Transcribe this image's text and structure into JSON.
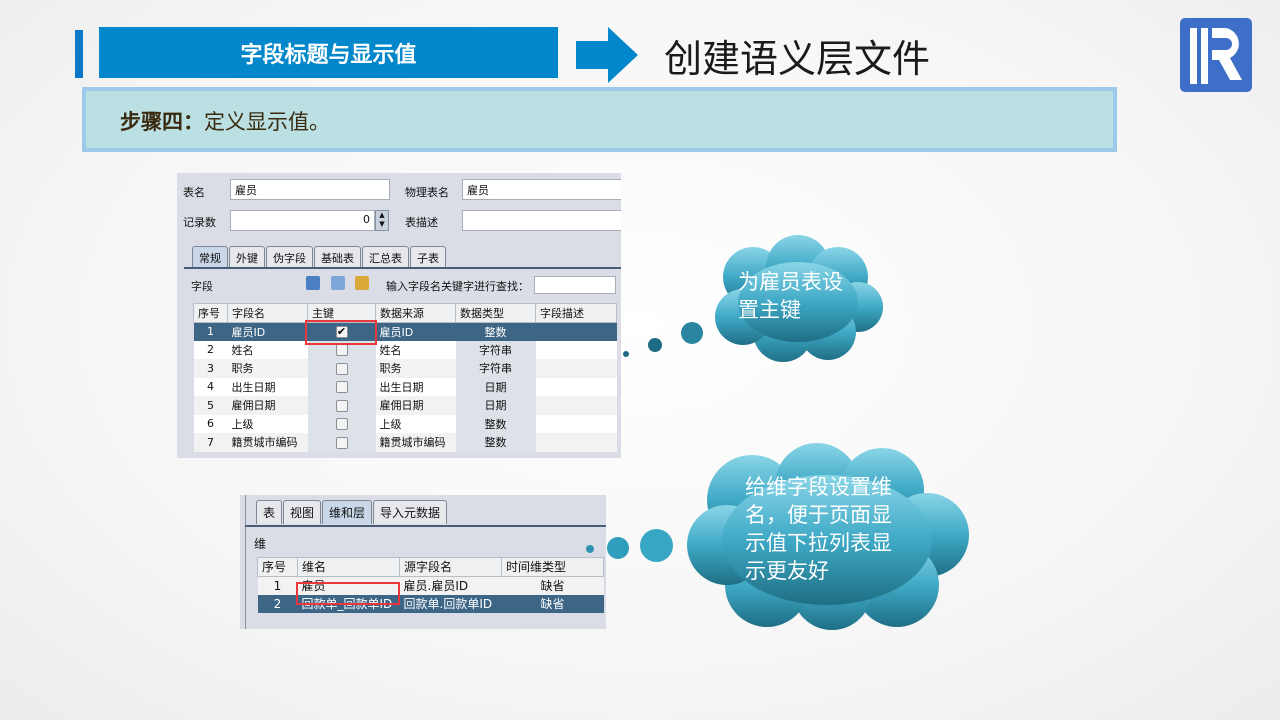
{
  "header": {
    "section_label": "字段标题与显示值",
    "main_title": "创建语义层文件",
    "logo_letter": "R"
  },
  "step": {
    "prefix": "步骤四：",
    "text": "定义显示值。"
  },
  "table_editor": {
    "table_name_label": "表名",
    "table_name": "雇员",
    "physical_name_label": "物理表名",
    "physical_name": "雇员",
    "record_count_label": "记录数",
    "record_count": "0",
    "table_desc_label": "表描述",
    "table_desc": "",
    "tabs": [
      "常规",
      "外键",
      "伪字段",
      "基础表",
      "汇总表",
      "子表"
    ],
    "fields_label": "字段",
    "search_label": "输入字段名关键字进行查找：",
    "search_value": "",
    "columns": [
      "序号",
      "字段名",
      "主键",
      "数据来源",
      "数据类型",
      "字段描述"
    ],
    "rows": [
      {
        "no": "1",
        "name": "雇员ID",
        "pk": true,
        "source": "雇员ID",
        "type": "整数",
        "desc": ""
      },
      {
        "no": "2",
        "name": "姓名",
        "pk": false,
        "source": "姓名",
        "type": "字符串",
        "desc": ""
      },
      {
        "no": "3",
        "name": "职务",
        "pk": false,
        "source": "职务",
        "type": "字符串",
        "desc": ""
      },
      {
        "no": "4",
        "name": "出生日期",
        "pk": false,
        "source": "出生日期",
        "type": "日期",
        "desc": ""
      },
      {
        "no": "5",
        "name": "雇佣日期",
        "pk": false,
        "source": "雇佣日期",
        "type": "日期",
        "desc": ""
      },
      {
        "no": "6",
        "name": "上级",
        "pk": false,
        "source": "上级",
        "type": "整数",
        "desc": ""
      },
      {
        "no": "7",
        "name": "籍贯城市编码",
        "pk": false,
        "source": "籍贯城市编码",
        "type": "整数",
        "desc": ""
      }
    ]
  },
  "dimension_editor": {
    "tabs": [
      "表",
      "视图",
      "维和层",
      "导入元数据"
    ],
    "dim_label": "维",
    "columns": [
      "序号",
      "维名",
      "源字段名",
      "时间维类型"
    ],
    "rows": [
      {
        "no": "1",
        "name": "雇员",
        "source": "雇员.雇员ID",
        "time_type": "缺省"
      },
      {
        "no": "2",
        "name": "回款单_回款单ID",
        "source": "回款单.回款单ID",
        "time_type": "缺省"
      }
    ]
  },
  "callouts": [
    "为雇员表设置主键",
    "给维字段设置维名，便于页面显示值下拉列表显示更友好"
  ],
  "colors": {
    "accent_blue": "#0387cb",
    "step_bg": "#bae0e3",
    "selected_row": "#3d6686",
    "highlight_red": "#e8383d",
    "cloud_top": "#86d3e6",
    "cloud_bottom": "#25788e"
  }
}
